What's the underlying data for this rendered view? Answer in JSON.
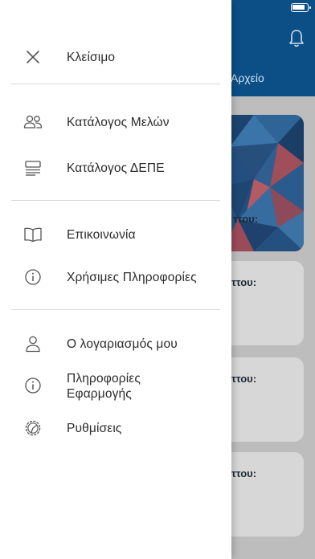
{
  "background": {
    "tab_label": "Αρχείο",
    "hero_text": "ττου:",
    "cards": [
      {
        "text": "ττου:"
      },
      {
        "text": "ττου:"
      },
      {
        "text": "ττου:"
      }
    ],
    "colors": {
      "header": "#0b4f86",
      "overlay": "#bdbdbd"
    }
  },
  "drawer": {
    "close": {
      "label": "Κλείσιμο",
      "icon": "close-icon"
    },
    "sections": [
      {
        "items": [
          {
            "label": "Κατάλογος Μελών",
            "icon": "people-icon"
          },
          {
            "label": "Κατάλογος ΔΕΠΕ",
            "icon": "list-icon"
          }
        ]
      },
      {
        "items": [
          {
            "label": "Επικοινωνία",
            "icon": "book-icon"
          },
          {
            "label": "Χρήσιμες Πληροφορίες",
            "icon": "info-icon"
          }
        ]
      },
      {
        "items": [
          {
            "label": "Ο λογαριασμός μου",
            "icon": "user-icon"
          },
          {
            "label": "Πληροφορίες Εφαρμογής",
            "icon": "info-icon"
          },
          {
            "label": "Ρυθμίσεις",
            "icon": "gear-icon"
          }
        ]
      }
    ]
  }
}
